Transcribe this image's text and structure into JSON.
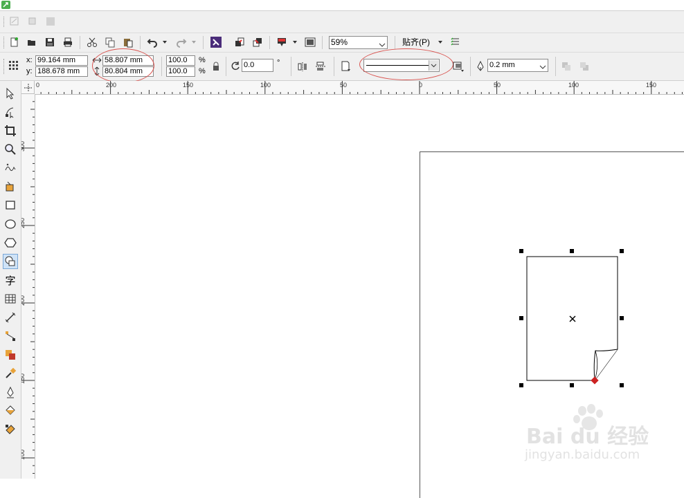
{
  "window": {
    "title": ""
  },
  "standard_toolbar": {
    "zoom_value": "59%",
    "snap_label": "贴齐(P)"
  },
  "property_bar": {
    "x_label": "x:",
    "y_label": "y:",
    "x_value": "99.164 mm",
    "y_value": "188.678 mm",
    "width_value": "58.807 mm",
    "height_value": "80.804 mm",
    "scale_x": "100.0",
    "scale_y": "100.0",
    "percent_sign": "%",
    "rotation_value": "0.0",
    "degree_sign": "°",
    "outline_width": "0.2 mm"
  },
  "horizontal_ruler": {
    "labels": [
      "0",
      "200",
      "150",
      "100",
      "50",
      "0",
      "50",
      "100",
      "150"
    ]
  },
  "vertical_ruler": {
    "labels": [
      "300",
      "250",
      "200",
      "150",
      "100"
    ]
  },
  "toolbox": {
    "tools": [
      "pick-tool",
      "shape-tool",
      "crop-tool",
      "zoom-tool",
      "freehand-tool",
      "smart-fill-tool",
      "rectangle-tool",
      "ellipse-tool",
      "polygon-tool",
      "basic-shapes-tool",
      "text-tool",
      "table-tool",
      "dimension-tool",
      "connector-tool",
      "interactive-effects-tool",
      "eyedropper-tool",
      "outline-tool",
      "fill-tool",
      "interactive-fill-tool"
    ],
    "text_tool_glyph": "字"
  },
  "colors": {
    "annotation_circle": "#d9534f",
    "toolbar_bg": "#f0f0f0",
    "selection_node": "#cc2222"
  },
  "watermark": {
    "brand_text": "Bai du 经验",
    "url_text": "jingyan.baidu.com"
  }
}
